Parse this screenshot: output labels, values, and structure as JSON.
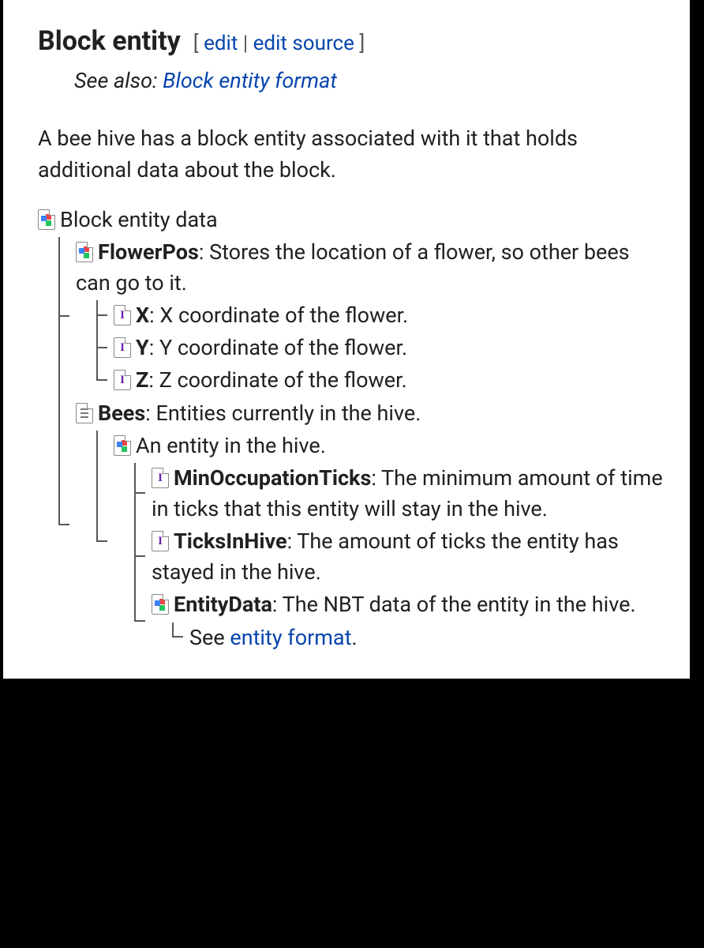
{
  "heading": "Block entity",
  "edit": {
    "open": "[ ",
    "edit": "edit",
    "sep": " | ",
    "edit_source": "edit source",
    "close": " ]"
  },
  "see_also": {
    "prefix": "See also: ",
    "link": "Block entity format"
  },
  "intro": "A bee hive has a block entity associated with it that holds additional data about the block.",
  "tree": {
    "root": "Block entity data",
    "flowerpos": {
      "label": "FlowerPos",
      "desc": ": Stores the location of a flower, so other bees can go to it."
    },
    "x": {
      "label": "X",
      "desc": ": X coordinate of the flower."
    },
    "y": {
      "label": "Y",
      "desc": ": Y coordinate of the flower."
    },
    "z": {
      "label": "Z",
      "desc": ": Z coordinate of the flower."
    },
    "bees": {
      "label": "Bees",
      "desc": ": Entities currently in the hive."
    },
    "entity": "An entity in the hive.",
    "minocc": {
      "label": "MinOccupationTicks",
      "desc": ": The minimum amount of time in ticks that this entity will stay in the hive."
    },
    "ticks": {
      "label": "TicksInHive",
      "desc": ": The amount of ticks the entity has stayed in the hive."
    },
    "entitydata": {
      "label": "EntityData",
      "desc": ": The NBT data of the entity in the hive."
    },
    "see_entity": {
      "prefix": "See ",
      "link": "entity format",
      "suffix": "."
    }
  }
}
